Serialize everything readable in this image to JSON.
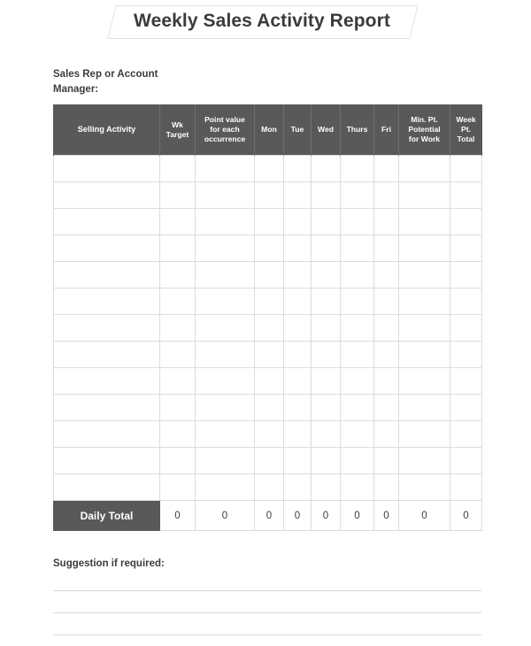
{
  "document": {
    "title": "Weekly Sales Activity Report"
  },
  "form": {
    "rep_label_line1": "Sales Rep or Account",
    "rep_label_line2": "Manager:",
    "suggestion_label": "Suggestion if required:",
    "suggestion_line_count": 3
  },
  "table": {
    "headers": [
      "Selling Activity",
      "Wk Target",
      "Point value for each occurrence",
      "Mon",
      "Tue",
      "Wed",
      "Thurs",
      "Fri",
      "Min. Pt. Potential for Work",
      "Week Pt. Total"
    ],
    "header_lines": [
      [
        "Selling Activity"
      ],
      [
        "Wk",
        "Target"
      ],
      [
        "Point value",
        "for each",
        "occurrence"
      ],
      [
        "Mon"
      ],
      [
        "Tue"
      ],
      [
        "Wed"
      ],
      [
        "Thurs"
      ],
      [
        "Fri"
      ],
      [
        "Min. Pt.",
        "Potential",
        "for Work"
      ],
      [
        "Week",
        "Pt.",
        "Total"
      ]
    ],
    "body_row_count": 13,
    "body_rows": [
      [
        "",
        "",
        "",
        "",
        "",
        "",
        "",
        "",
        "",
        ""
      ],
      [
        "",
        "",
        "",
        "",
        "",
        "",
        "",
        "",
        "",
        ""
      ],
      [
        "",
        "",
        "",
        "",
        "",
        "",
        "",
        "",
        "",
        ""
      ],
      [
        "",
        "",
        "",
        "",
        "",
        "",
        "",
        "",
        "",
        ""
      ],
      [
        "",
        "",
        "",
        "",
        "",
        "",
        "",
        "",
        "",
        ""
      ],
      [
        "",
        "",
        "",
        "",
        "",
        "",
        "",
        "",
        "",
        ""
      ],
      [
        "",
        "",
        "",
        "",
        "",
        "",
        "",
        "",
        "",
        ""
      ],
      [
        "",
        "",
        "",
        "",
        "",
        "",
        "",
        "",
        "",
        ""
      ],
      [
        "",
        "",
        "",
        "",
        "",
        "",
        "",
        "",
        "",
        ""
      ],
      [
        "",
        "",
        "",
        "",
        "",
        "",
        "",
        "",
        "",
        ""
      ],
      [
        "",
        "",
        "",
        "",
        "",
        "",
        "",
        "",
        "",
        ""
      ],
      [
        "",
        "",
        "",
        "",
        "",
        "",
        "",
        "",
        "",
        ""
      ],
      [
        "",
        "",
        "",
        "",
        "",
        "",
        "",
        "",
        "",
        ""
      ]
    ],
    "footer": {
      "label": "Daily Total",
      "values": [
        "0",
        "0",
        "0",
        "0",
        "0",
        "0",
        "0",
        "0",
        "0"
      ]
    }
  },
  "colors": {
    "header_bg": "#595959",
    "header_text": "#ffffff",
    "grid_line": "#dcdcdc",
    "body_text": "#3d3d3d",
    "rule_line": "#d8d8d8",
    "page_bg": "#ffffff"
  }
}
